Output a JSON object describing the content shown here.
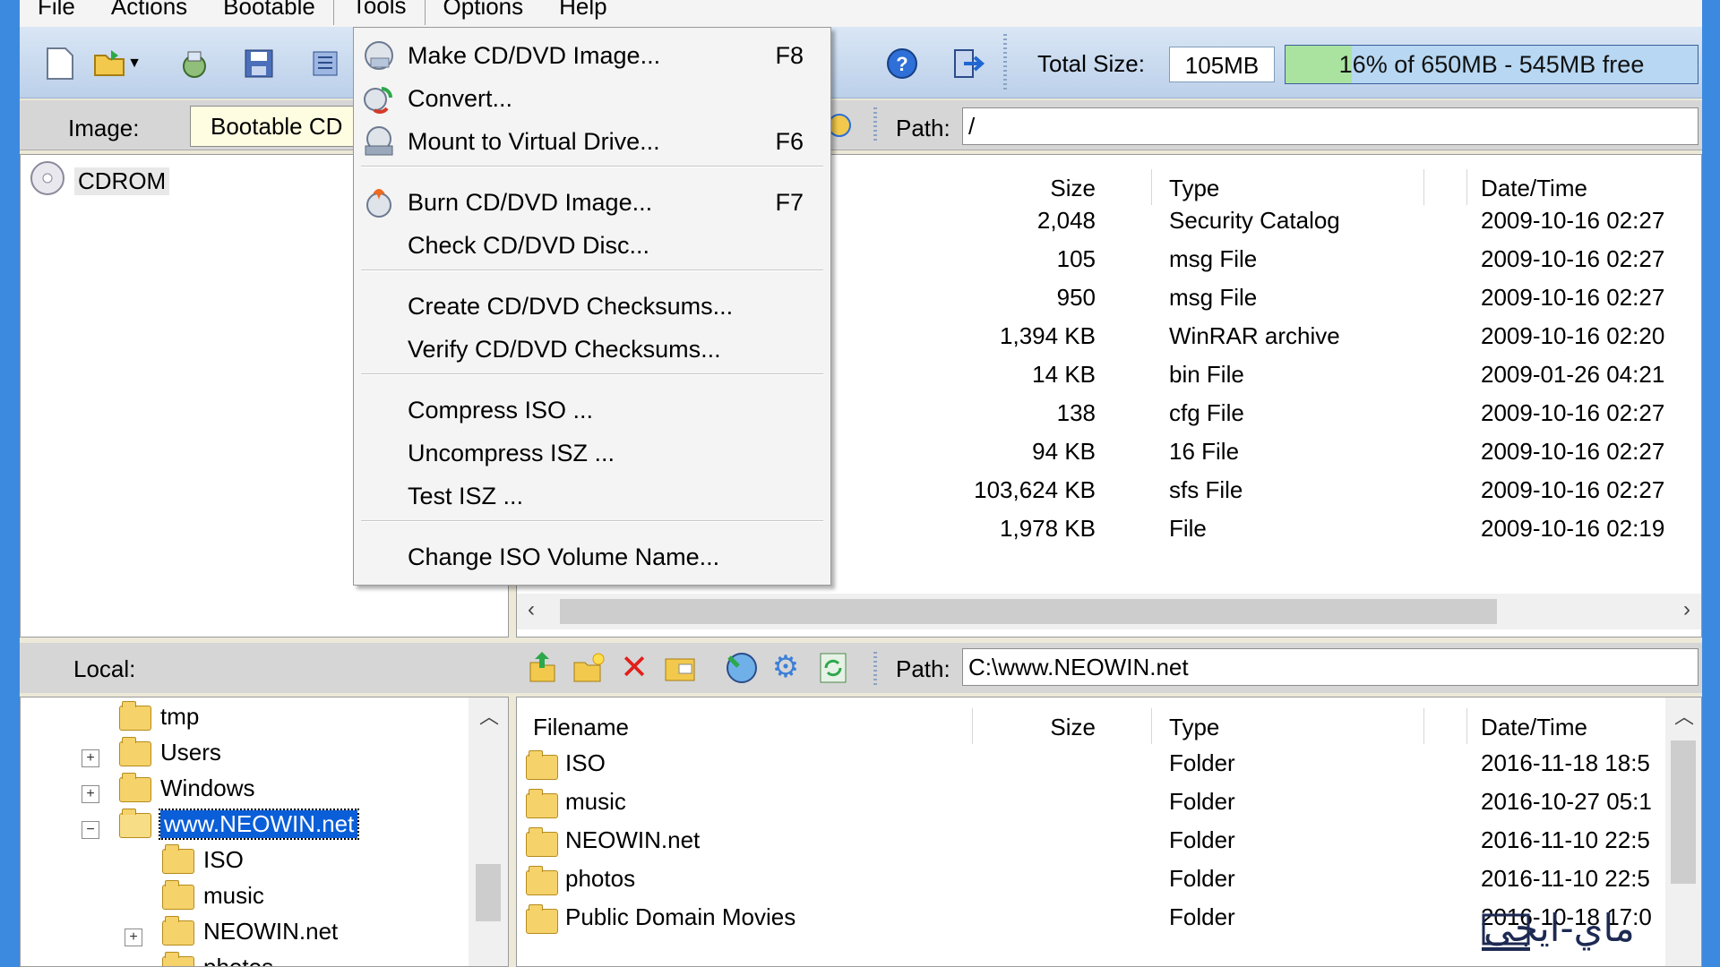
{
  "menubar": {
    "items": [
      "File",
      "Actions",
      "Bootable",
      "Tools",
      "Options",
      "Help"
    ],
    "active": "Tools"
  },
  "toolbar": {
    "total_size_label": "Total Size:",
    "total_size_value": "105MB",
    "usage_text": "16% of 650MB - 545MB free",
    "usage_fraction": 0.16,
    "icons": [
      "new-icon",
      "open-icon",
      "dropdown-arrow-icon",
      "extract-icon",
      "save-icon",
      "properties-icon",
      "help-icon",
      "exit-icon"
    ]
  },
  "image_bar": {
    "image_label": "Image:",
    "image_value": "Bootable CD",
    "path_label": "Path:",
    "path_value": "/"
  },
  "image_tree": {
    "root": "CDROM"
  },
  "image_list": {
    "columns": {
      "size": "Size",
      "type": "Type",
      "date": "Date/Time"
    },
    "rows": [
      {
        "size": "2,048",
        "type": "Security Catalog",
        "date": "2009-10-16 02:27"
      },
      {
        "size": "105",
        "type": "msg File",
        "date": "2009-10-16 02:27"
      },
      {
        "size": "950",
        "type": "msg File",
        "date": "2009-10-16 02:27"
      },
      {
        "size": "1,394 KB",
        "type": "WinRAR archive",
        "date": "2009-10-16 02:20"
      },
      {
        "size": "14 KB",
        "type": "bin File",
        "date": "2009-01-26 04:21"
      },
      {
        "size": "138",
        "type": "cfg File",
        "date": "2009-10-16 02:27"
      },
      {
        "size": "94 KB",
        "type": "16 File",
        "date": "2009-10-16 02:27"
      },
      {
        "size": "103,624 KB",
        "type": "sfs File",
        "date": "2009-10-16 02:27"
      },
      {
        "size": "1,978 KB",
        "type": "File",
        "date": "2009-10-16 02:19"
      }
    ]
  },
  "tools_menu": {
    "items": [
      {
        "label": "Make CD/DVD Image...",
        "shortcut": "F8",
        "icon": "make-image-icon"
      },
      {
        "label": "Convert...",
        "shortcut": "",
        "icon": "convert-icon"
      },
      {
        "label": "Mount to Virtual Drive...",
        "shortcut": "F6",
        "icon": "mount-icon"
      },
      {
        "label": "Burn CD/DVD Image...",
        "shortcut": "F7",
        "icon": "burn-icon"
      },
      {
        "label": "Check CD/DVD Disc...",
        "shortcut": "",
        "icon": ""
      },
      {
        "label": "Create CD/DVD Checksums...",
        "shortcut": "",
        "icon": ""
      },
      {
        "label": "Verify CD/DVD Checksums...",
        "shortcut": "",
        "icon": ""
      },
      {
        "label": "Compress ISO ...",
        "shortcut": "",
        "icon": ""
      },
      {
        "label": "Uncompress ISZ ...",
        "shortcut": "",
        "icon": ""
      },
      {
        "label": "Test ISZ ...",
        "shortcut": "",
        "icon": ""
      },
      {
        "label": "Change ISO Volume Name...",
        "shortcut": "",
        "icon": ""
      }
    ]
  },
  "local_bar": {
    "label": "Local:",
    "path_label": "Path:",
    "path_value": "C:\\www.NEOWIN.net"
  },
  "local_tree": {
    "items": [
      "tmp",
      "Users",
      "Windows",
      "www.NEOWIN.net",
      "ISO",
      "music",
      "NEOWIN.net",
      "photos"
    ]
  },
  "local_list": {
    "columns": {
      "filename": "Filename",
      "size": "Size",
      "type": "Type",
      "date": "Date/Time"
    },
    "rows": [
      {
        "name": "ISO",
        "type": "Folder",
        "date": "2016-11-18 18:5"
      },
      {
        "name": "music",
        "type": "Folder",
        "date": "2016-10-27 05:1"
      },
      {
        "name": "NEOWIN.net",
        "type": "Folder",
        "date": "2016-11-10 22:5"
      },
      {
        "name": "photos",
        "type": "Folder",
        "date": "2016-11-10 22:5"
      },
      {
        "name": "Public Domain Movies",
        "type": "Folder",
        "date": "2016-10-18 17:0"
      }
    ]
  },
  "watermark": {
    "text": "ماي-ايجي"
  }
}
